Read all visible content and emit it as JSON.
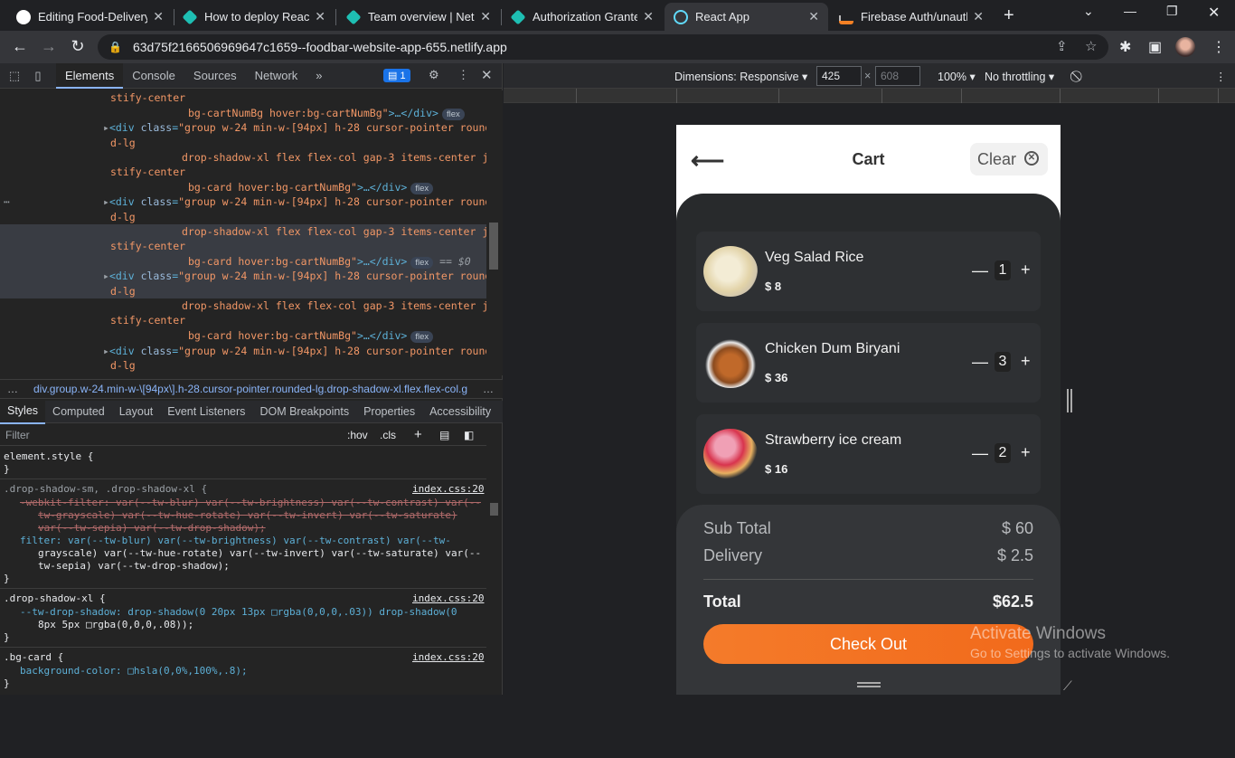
{
  "tabs": [
    {
      "title": "Editing Food-Delivery",
      "favicon": "github-icon",
      "color": "#ffffff"
    },
    {
      "title": "How to deploy React A",
      "favicon": "netlify-icon",
      "color": "#1ebfb3"
    },
    {
      "title": "Team overview | Netlif",
      "favicon": "netlify-icon",
      "color": "#1ebfb3"
    },
    {
      "title": "Authorization Granted",
      "favicon": "netlify-icon",
      "color": "#1ebfb3"
    },
    {
      "title": "React App",
      "favicon": "react-icon",
      "color": "#61dafb"
    },
    {
      "title": "Firebase Auth/unauth",
      "favicon": "stackoverflow-icon",
      "color": "#f48024"
    }
  ],
  "address": {
    "url": "63d75f2166506969647c1659--foodbar-website-app-655.netlify.app"
  },
  "devtools": {
    "tabs": [
      "Elements",
      "Console",
      "Sources",
      "Network"
    ],
    "issues_count": "1",
    "dom_lines": [
      "stify-center",
      "bg-cartNumBg hover:bg-cartNumBg\">…</div>",
      "<div class=\"group w-24 min-w-[94px] h-28 cursor-pointer rounde",
      "d-lg",
      "drop-shadow-xl flex flex-col gap-3 items-center ju",
      "stify-center",
      "bg-card hover:bg-cartNumBg\">…</div>"
    ],
    "selected_suffix": "== $0",
    "flex_badge": "flex",
    "breadcrumb": "div.group.w-24.min-w-\\[94px\\].h-28.cursor-pointer.rounded-lg.drop-shadow-xl.flex.flex-col.g",
    "styles_tabs": [
      "Styles",
      "Computed",
      "Layout",
      "Event Listeners",
      "DOM Breakpoints",
      "Properties",
      "Accessibility"
    ],
    "filter_placeholder": "Filter",
    "filter_hov": ":hov",
    "filter_cls": ".cls",
    "css": {
      "element_style": "element.style {",
      "close": "}",
      "rule1_selector": ".drop-shadow-sm, .drop-shadow-xl {",
      "rule1_source": "index.css:20",
      "rule1_struck_1": "-webkit-filter: var(--tw-blur) var(--tw-brightness) var(--tw-contrast) var(--",
      "rule1_struck_2": "tw-grayscale) var(--tw-hue-rotate) var(--tw-invert) var(--tw-saturate)",
      "rule1_struck_3": "var(--tw-sepia) var(--tw-drop-shadow);",
      "rule1_filter_1": "filter: var(--tw-blur) var(--tw-brightness) var(--tw-contrast) var(--tw-",
      "rule1_filter_2": "grayscale) var(--tw-hue-rotate) var(--tw-invert) var(--tw-saturate) var(--",
      "rule1_filter_3": "tw-sepia) var(--tw-drop-shadow);",
      "rule2_selector": ".drop-shadow-xl {",
      "rule2_source": "index.css:20",
      "rule2_line1": "--tw-drop-shadow: drop-shadow(0 20px 13px □rgba(0,0,0,.03)) drop-shadow(0",
      "rule2_line2": "8px 5px □rgba(0,0,0,.08));",
      "rule3_selector": ".bg-card {",
      "rule3_source": "index.css:20",
      "rule3_line1": "background-color: □hsla(0,0%,100%,.8);"
    }
  },
  "responsive": {
    "dimensions_label": "Dimensions: Responsive",
    "width": "425",
    "height": "608",
    "zoom": "100%",
    "throttling": "No throttling"
  },
  "app": {
    "title": "Cart",
    "clear_label": "Clear",
    "items": [
      {
        "name": "Veg Salad Rice",
        "price": "$ 8",
        "qty": "1"
      },
      {
        "name": "Chicken Dum Biryani",
        "price": "$ 36",
        "qty": "3"
      },
      {
        "name": "Strawberry ice cream",
        "price": "$ 16",
        "qty": "2"
      }
    ],
    "subtotal_label": "Sub Total",
    "subtotal": "$ 60",
    "delivery_label": "Delivery",
    "delivery": "$ 2.5",
    "total_label": "Total",
    "total": "$62.5",
    "checkout_label": "Check Out"
  },
  "watermark": {
    "line1": "Activate Windows",
    "line2": "Go to Settings to activate Windows."
  }
}
